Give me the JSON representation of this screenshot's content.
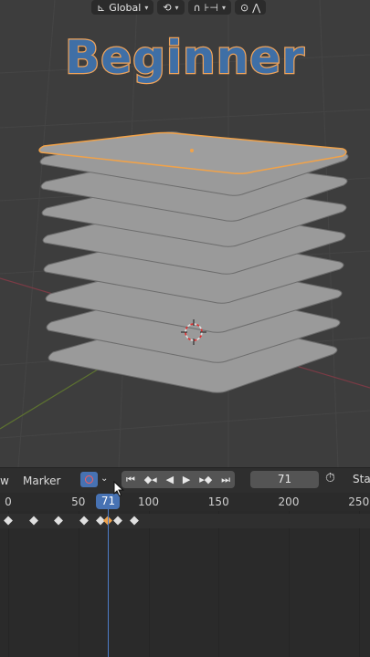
{
  "viewport_header": {
    "orientation_label": "Global"
  },
  "overlay_title": "Beginner",
  "timeline": {
    "menu_view_partial": "w",
    "menu_marker": "Marker",
    "current_frame": "71",
    "start_partial": "Sta",
    "ruler_ticks": [
      "0",
      "50",
      "100",
      "150",
      "200",
      "250"
    ],
    "ruler_tick_values": [
      0,
      50,
      100,
      150,
      200,
      250
    ],
    "playhead_frame": 71,
    "keyframe_frames": [
      0,
      18,
      36,
      54,
      66,
      78,
      90,
      71
    ],
    "selected_keyframe_frame": 71,
    "playback_icons": [
      "jump-start-icon",
      "prev-keyframe-icon",
      "play-reverse-icon",
      "play-icon",
      "next-keyframe-icon",
      "jump-end-icon"
    ]
  },
  "colors": {
    "accent": "#4772b3",
    "selection": "#f0a24a",
    "title_fill": "#3f6fa6",
    "title_outline": "#f0a45b"
  }
}
